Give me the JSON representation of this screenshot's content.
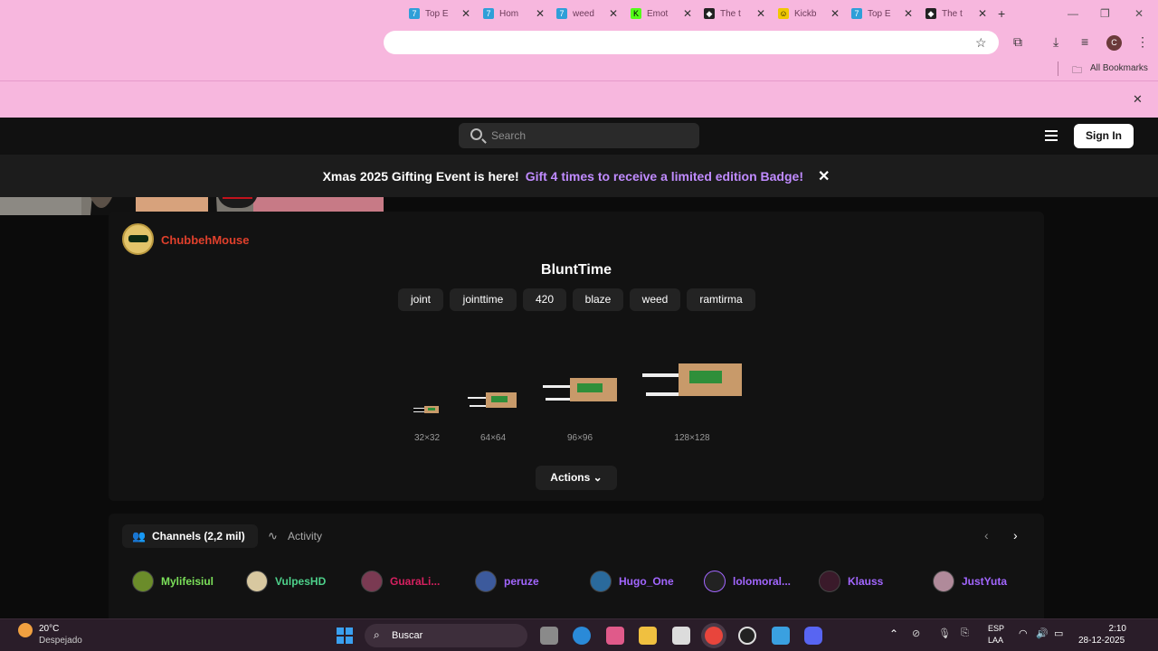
{
  "browser": {
    "tabs": [
      {
        "label": "Top E",
        "favicon": "7tv-icon",
        "color": "#2f9fd8"
      },
      {
        "label": "Hom",
        "favicon": "7tv-icon",
        "color": "#2f9fd8"
      },
      {
        "label": "weed",
        "favicon": "7tv-icon",
        "color": "#2f9fd8"
      },
      {
        "label": "Emot",
        "favicon": "kick-icon",
        "color": "#53fc18"
      },
      {
        "label": "The t",
        "favicon": "app-icon",
        "color": "#222"
      },
      {
        "label": "Kickb",
        "favicon": "kickbot-icon",
        "color": "#f0c800"
      },
      {
        "label": "Top E",
        "favicon": "7tv-icon",
        "color": "#2f9fd8"
      },
      {
        "label": "The t",
        "favicon": "app-icon",
        "color": "#222"
      }
    ],
    "new_tab": "+",
    "bookmarks_label": "All Bookmarks",
    "profile_initial": "C"
  },
  "site": {
    "search_placeholder": "Search",
    "signin_label": "Sign In",
    "banner_prefix": "Xmas 2025 Gifting Event is here!",
    "banner_link": "Gift 4 times to receive a limited edition Badge!",
    "banner_link_color": "#c08bff"
  },
  "emote": {
    "owner": "ChubbehMouse",
    "owner_color": "#e0402c",
    "name": "BluntTime",
    "tags": [
      "joint",
      "jointtime",
      "420",
      "blaze",
      "weed",
      "ramtirma"
    ],
    "sizes": [
      "32×32",
      "64×64",
      "96×96",
      "128×128"
    ],
    "actions_label": "Actions"
  },
  "channels_panel": {
    "channels_tab": "Channels (2,2 mil)",
    "activity_tab": "Activity",
    "channels": [
      {
        "name": "Mylifeisiul",
        "color": "#7be05a"
      },
      {
        "name": "VulpesHD",
        "color": "#4dd08a"
      },
      {
        "name": "GuaraLi...",
        "color": "#d62060"
      },
      {
        "name": "peruze",
        "color": "#a266ff"
      },
      {
        "name": "Hugo_One",
        "color": "#a266ff"
      },
      {
        "name": "lolomoral...",
        "color": "#a266ff"
      },
      {
        "name": "Klauss",
        "color": "#a266ff"
      },
      {
        "name": "JustYuta",
        "color": "#a266ff"
      }
    ]
  },
  "taskbar": {
    "weather_temp": "20°C",
    "weather_desc": "Despejado",
    "search_label": "Buscar",
    "lang_1": "ESP",
    "lang_2": "LAA",
    "time": "2:10",
    "date": "28-12-2025"
  }
}
